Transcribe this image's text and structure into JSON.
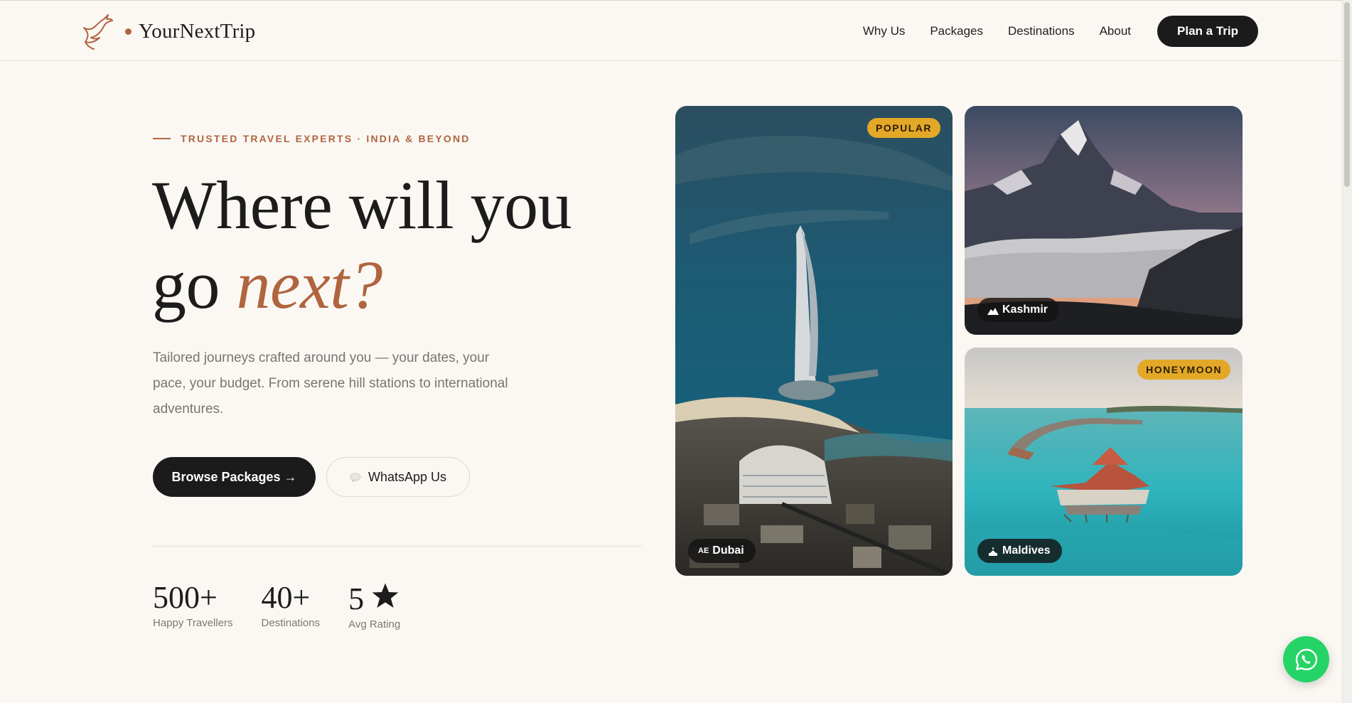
{
  "brand": {
    "name": "YourNextTrip",
    "accent_color": "#b0653f"
  },
  "nav": {
    "links": [
      "Why Us",
      "Packages",
      "Destinations",
      "About"
    ],
    "cta": "Plan a Trip"
  },
  "hero": {
    "eyebrow": "TRUSTED TRAVEL EXPERTS · INDIA & BEYOND",
    "headline_line1": "Where will you",
    "headline_line2_plain": "go ",
    "headline_line2_accent": "next?",
    "subtext": "Tailored journeys crafted around you — your dates, your pace, your budget. From serene hill stations to international adventures.",
    "primary_button": "Browse Packages →",
    "secondary_button": "WhatsApp Us"
  },
  "stats": [
    {
      "value": "500+",
      "label": "Happy Travellers"
    },
    {
      "value": "40+",
      "label": "Destinations"
    },
    {
      "value": "5",
      "label": "Avg Rating",
      "icon": "star-icon"
    }
  ],
  "cards": [
    {
      "place": "Dubai",
      "flag": "AE",
      "badge": "POPULAR"
    },
    {
      "place": "Kashmir",
      "icon": "mountain-icon"
    },
    {
      "place": "Maldives",
      "icon": "island-icon",
      "badge": "HONEYMOON"
    }
  ],
  "colors": {
    "badge": "#e4a828",
    "whatsapp": "#25d366",
    "dark": "#1b1b1b"
  }
}
